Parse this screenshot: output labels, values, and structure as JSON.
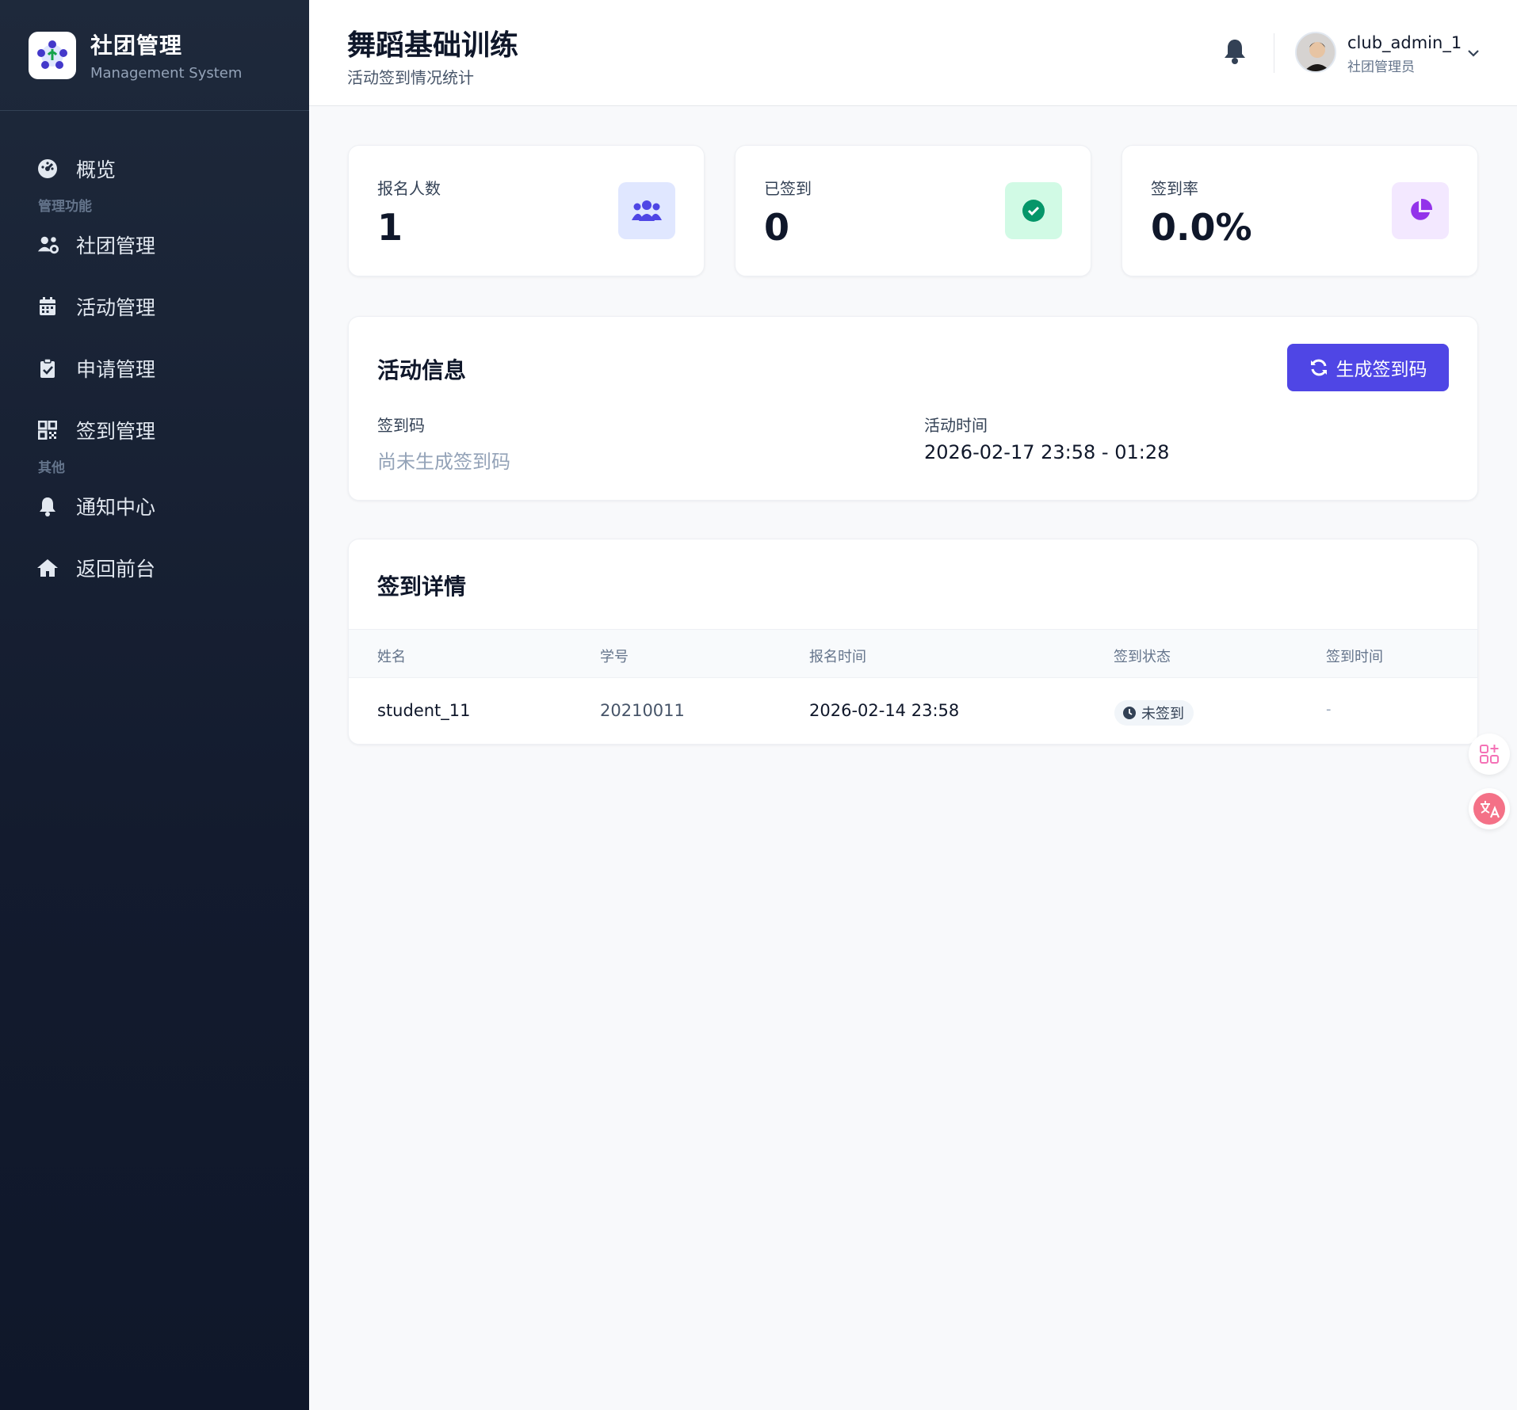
{
  "sidebar": {
    "brand_title": "社团管理",
    "brand_subtitle": "Management System",
    "items": [
      {
        "label": "概览",
        "icon": "dashboard-icon"
      },
      {
        "label": "社团管理",
        "icon": "users-cog-icon"
      },
      {
        "label": "活动管理",
        "icon": "calendar-icon"
      },
      {
        "label": "申请管理",
        "icon": "clipboard-check-icon"
      },
      {
        "label": "签到管理",
        "icon": "qrcode-icon"
      },
      {
        "label": "通知中心",
        "icon": "bell-icon"
      },
      {
        "label": "返回前台",
        "icon": "home-icon"
      }
    ],
    "groups": {
      "manage": "管理功能",
      "other": "其他"
    }
  },
  "header": {
    "title": "舞蹈基础训练",
    "subtitle": "活动签到情况统计",
    "user_name": "club_admin_1",
    "user_role": "社团管理员"
  },
  "stats": [
    {
      "label": "报名人数",
      "value": "1",
      "icon": "users-icon",
      "color": "#4f46e5",
      "bg": "#e0e7ff"
    },
    {
      "label": "已签到",
      "value": "0",
      "icon": "check-circle-icon",
      "color": "#059669",
      "bg": "#d1fae5"
    },
    {
      "label": "签到率",
      "value": "0.0%",
      "icon": "pie-chart-icon",
      "color": "#9333ea",
      "bg": "#f3e8ff"
    }
  ],
  "activity_info": {
    "title": "活动信息",
    "generate_button": "生成签到码",
    "code_label": "签到码",
    "code_value": "尚未生成签到码",
    "time_label": "活动时间",
    "time_value": "2026-02-17 23:58 - 01:28"
  },
  "checkin_details": {
    "title": "签到详情",
    "columns": [
      "姓名",
      "学号",
      "报名时间",
      "签到状态",
      "签到时间"
    ],
    "rows": [
      {
        "name": "student_11",
        "student_id": "20210011",
        "signup_time": "2026-02-14 23:58",
        "status": "未签到",
        "checkin_time": "-"
      }
    ]
  },
  "colors": {
    "accent": "#4f46e5",
    "sidebar_bg": "#1e293b"
  }
}
